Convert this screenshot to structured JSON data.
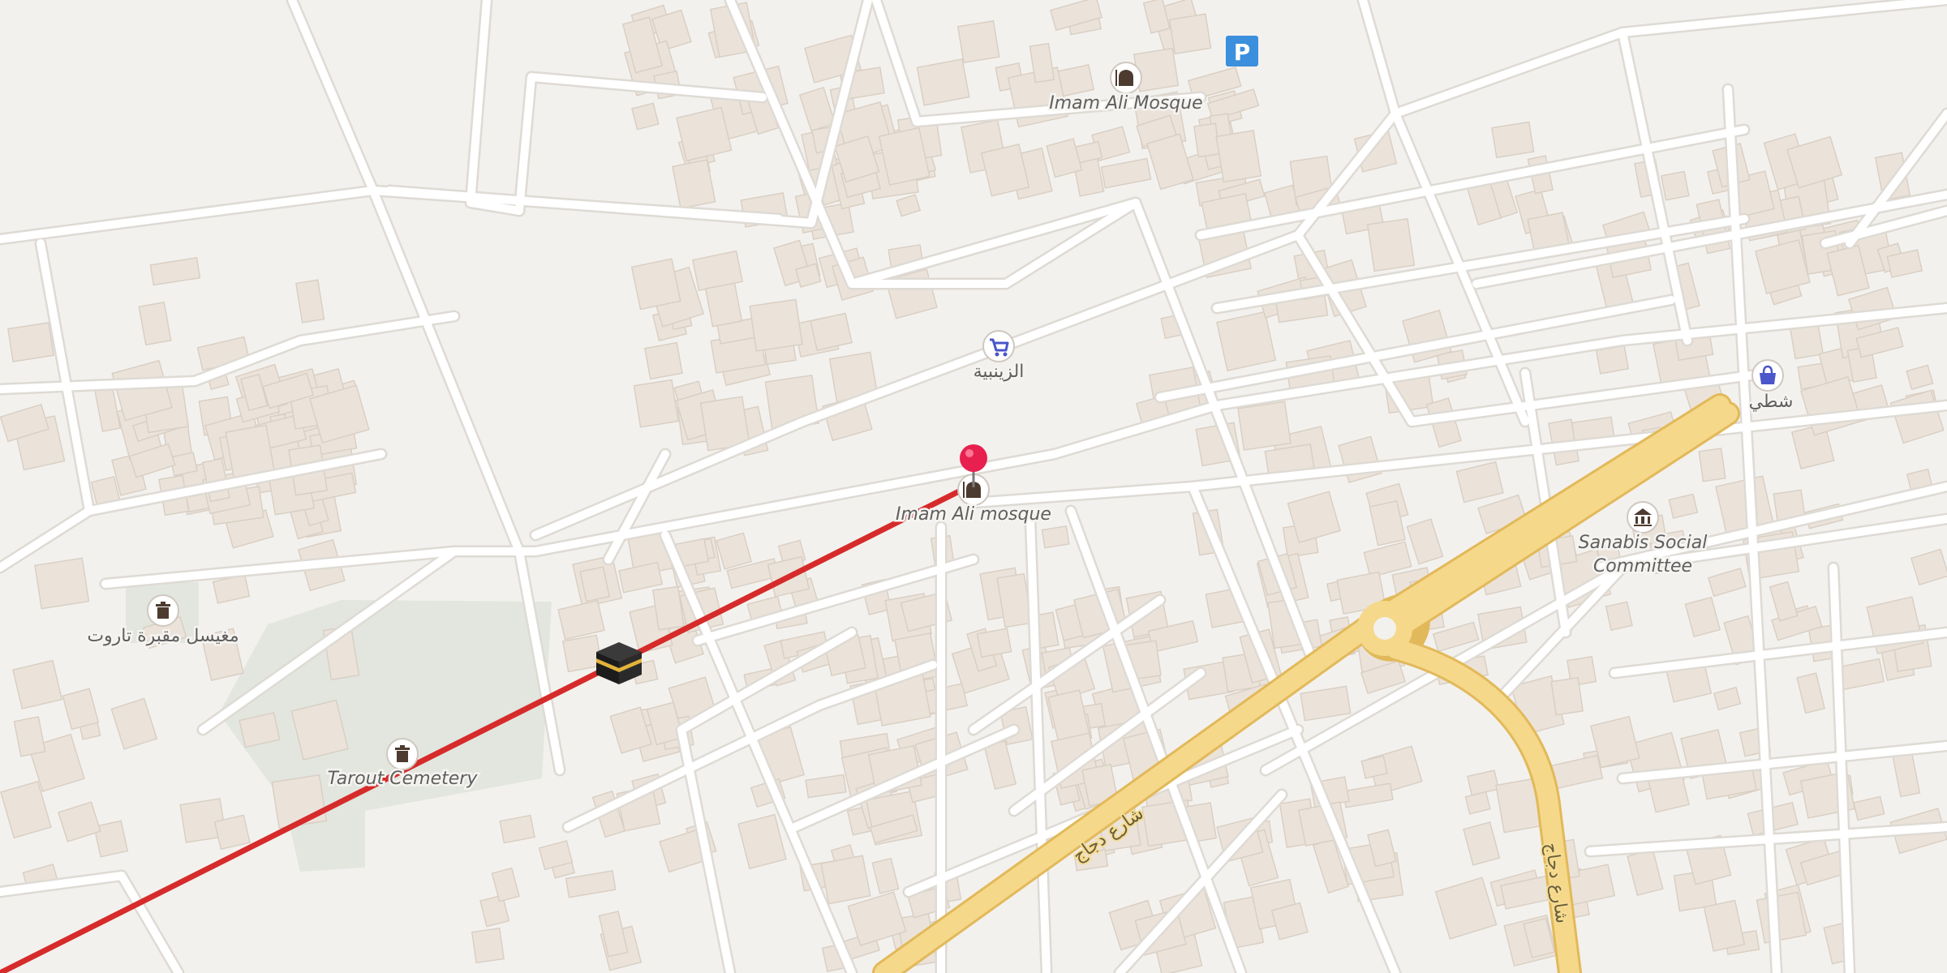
{
  "map": {
    "colors": {
      "background": "#f3f1ee",
      "building": "#ebe3da",
      "building_edge": "#d9cfc4",
      "minor_road": "#ffffff",
      "minor_road_casing": "#dedad4",
      "major_road": "#f5d88a",
      "major_road_casing": "#e2b95a",
      "park": "#e2e6df",
      "route_line": "#d62b2b",
      "pin": "#e8204f",
      "poi_icon_bg": "#ffffff",
      "poi_icon": "#4d3b30",
      "shop_icon": "#4a56c9",
      "parking": "#3b8fdc"
    },
    "labels": {
      "imam_ali_mosque_north": "Imam Ali Mosque",
      "imam_ali_mosque_pin": "Imam Ali mosque",
      "shop_zainabiya": "الزينبية",
      "shop_east": "شطي",
      "sanabis_committee_line1": "Sanabis Social",
      "sanabis_committee_line2": "Committee",
      "cemetery_washroom": "مغيسل مقبرة تاروت",
      "tarout_cemetery": "Tarout Cemetery",
      "road_diagonal": "شارع دجاج",
      "road_curve": "شارع دجاج"
    },
    "parking_label": "P",
    "icons": {
      "pin": "map-pin-icon",
      "mosque": "mosque-icon",
      "shop": "shopping-cart-icon",
      "bag": "shopping-bag-icon",
      "civic": "civic-building-icon",
      "cemetery": "cemetery-icon",
      "kaaba": "kaaba-icon",
      "parking": "parking-icon"
    }
  }
}
